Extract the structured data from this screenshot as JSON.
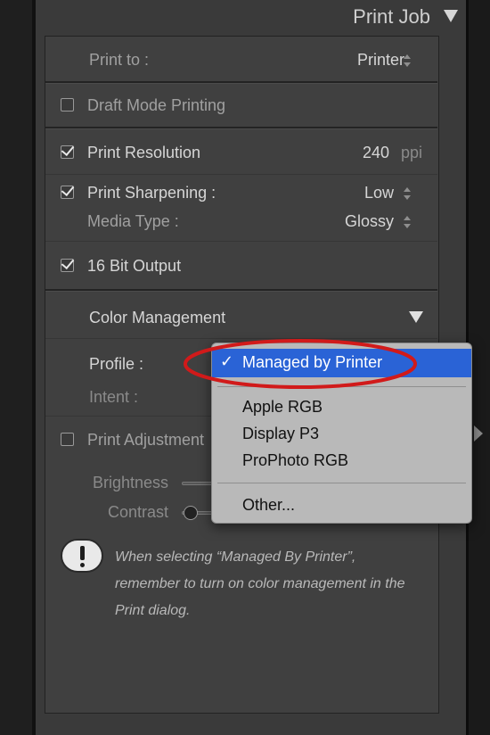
{
  "panel": {
    "title": "Print Job"
  },
  "print_to": {
    "label": "Print to :",
    "value": "Printer"
  },
  "draft_mode": {
    "label": "Draft Mode Printing",
    "checked": false
  },
  "print_resolution": {
    "label": "Print Resolution",
    "value": "240",
    "unit": "ppi",
    "checked": true
  },
  "print_sharpening": {
    "label": "Print Sharpening :",
    "value": "Low",
    "checked": true
  },
  "media_type": {
    "label": "Media Type :",
    "value": "Glossy"
  },
  "bit_output": {
    "label": "16 Bit Output",
    "checked": true
  },
  "color_management": {
    "title": "Color Management",
    "profile_label": "Profile :",
    "intent_label": "Intent :"
  },
  "print_adjustment": {
    "label": "Print Adjustment",
    "checked": false,
    "brightness_label": "Brightness",
    "contrast_label": "Contrast"
  },
  "note": {
    "text": "When selecting “Managed By Printer”, remember to turn on color management in the Print dialog."
  },
  "profile_menu": {
    "selected": "Managed by Printer",
    "check": "✓",
    "options": [
      "Apple RGB",
      "Display P3",
      "ProPhoto RGB"
    ],
    "other": "Other..."
  },
  "colors": {
    "highlight": "#2a63d6",
    "annotation": "#d11a1a"
  }
}
